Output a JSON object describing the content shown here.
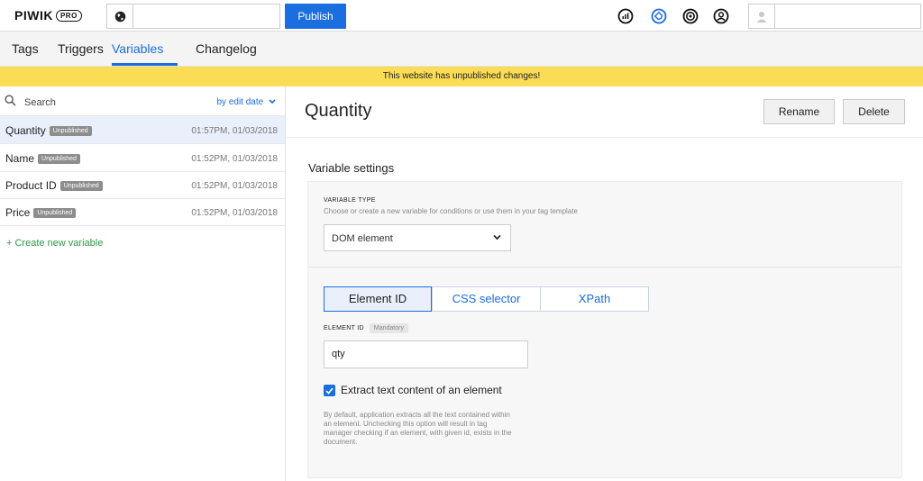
{
  "topbar": {
    "logo": "PIWIK",
    "logo_badge": "PRO",
    "site_value": "",
    "publish_label": "Publish",
    "icons": [
      "analytics-icon",
      "tag-manager-icon",
      "target-icon",
      "user-circle-icon"
    ],
    "accent": "#1b6ee0",
    "user_value": ""
  },
  "nav": {
    "tabs": [
      {
        "label": "Tags"
      },
      {
        "label": "Triggers"
      },
      {
        "label": "Variables",
        "active": true
      },
      {
        "label": "Changelog"
      }
    ]
  },
  "banner": {
    "text": "This website has unpublished changes!",
    "color": "#fbdc55"
  },
  "sidebar": {
    "search_placeholder": "Search",
    "sort_label": "by edit date",
    "items": [
      {
        "name": "Quantity",
        "badge": "Unpublished",
        "date": "01:57PM, 01/03/2018",
        "selected": true
      },
      {
        "name": "Name",
        "badge": "Unpublished",
        "date": "01:52PM, 01/03/2018"
      },
      {
        "name": "Product ID",
        "badge": "Unpublished",
        "date": "01:52PM, 01/03/2018"
      },
      {
        "name": "Price",
        "badge": "Unpublished",
        "date": "01:52PM, 01/03/2018"
      }
    ],
    "create_label": "+ Create new variable"
  },
  "main": {
    "title": "Quantity",
    "rename_label": "Rename",
    "delete_label": "Delete",
    "section_title": "Variable settings",
    "variable_type": {
      "label": "VARIABLE TYPE",
      "help": "Choose or create a new variable for conditions or use them in your tag template",
      "selected": "DOM element"
    },
    "selector_tabs": [
      {
        "label": "Element ID",
        "active": true
      },
      {
        "label": "CSS selector"
      },
      {
        "label": "XPath"
      }
    ],
    "element_id": {
      "label": "ELEMENT ID",
      "badge": "Mandatory",
      "value": "qty"
    },
    "extract_text": {
      "label": "Extract text content of an element",
      "checked": true,
      "description": "By default, application extracts all the text contained within an element. Unchecking this option will result in tag manager checking if an element, with given id, exists in the document."
    }
  }
}
